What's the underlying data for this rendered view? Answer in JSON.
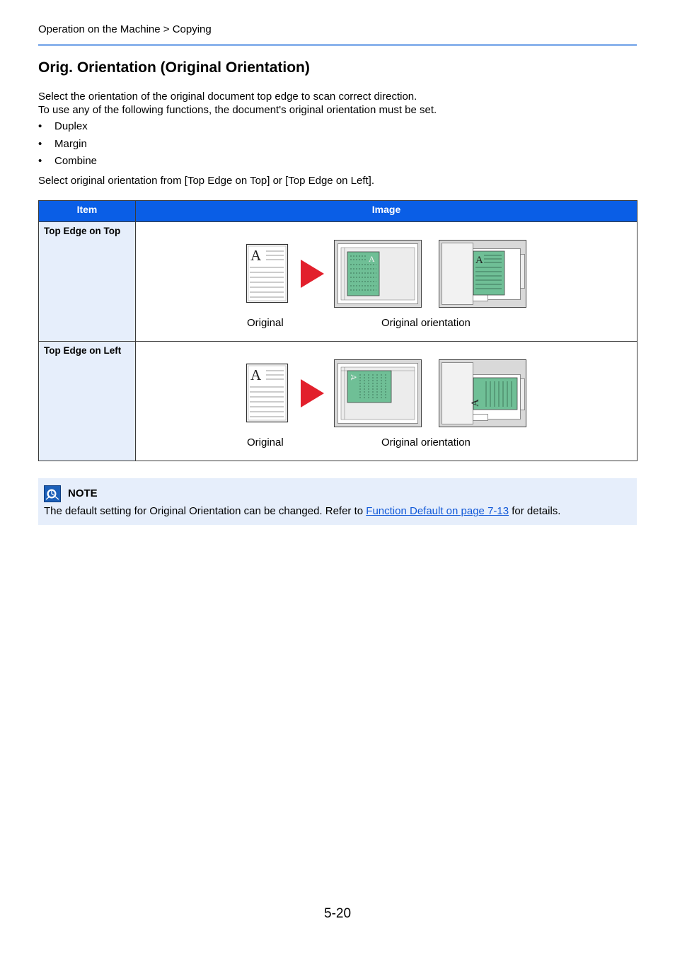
{
  "header": {
    "breadcrumb": "Operation on the Machine > Copying"
  },
  "title": "Orig. Orientation (Original Orientation)",
  "intro": {
    "line1": "Select the orientation of the original document top edge to scan correct direction.",
    "line2": "To use any of the following functions, the document's original orientation must be set."
  },
  "bullets": [
    "Duplex",
    "Margin",
    "Combine"
  ],
  "bullet_char": "•",
  "select_text": "Select original orientation from [Top Edge on Top] or [Top Edge on Left].",
  "table": {
    "headers": {
      "item": "Item",
      "image": "Image"
    },
    "rows": [
      {
        "item": "Top Edge on Top",
        "caption_original": "Original",
        "caption_orientation": "Original orientation",
        "glyph": "A"
      },
      {
        "item": "Top Edge on Left",
        "caption_original": "Original",
        "caption_orientation": "Original orientation",
        "glyph": "A"
      }
    ]
  },
  "note": {
    "label": "NOTE",
    "text_before": "The default setting for Original Orientation can be changed. Refer to ",
    "link_text": "Function Default on page 7-13",
    "text_after": " for details."
  },
  "page_number": "5-20",
  "colors": {
    "header_blue": "#0a5ee6",
    "light_blue": "#e6eefb",
    "rule_blue": "#8cb4ec",
    "arrow_red": "#e2202c",
    "paper_green": "#6fbf96",
    "link_blue": "#1058d8"
  }
}
